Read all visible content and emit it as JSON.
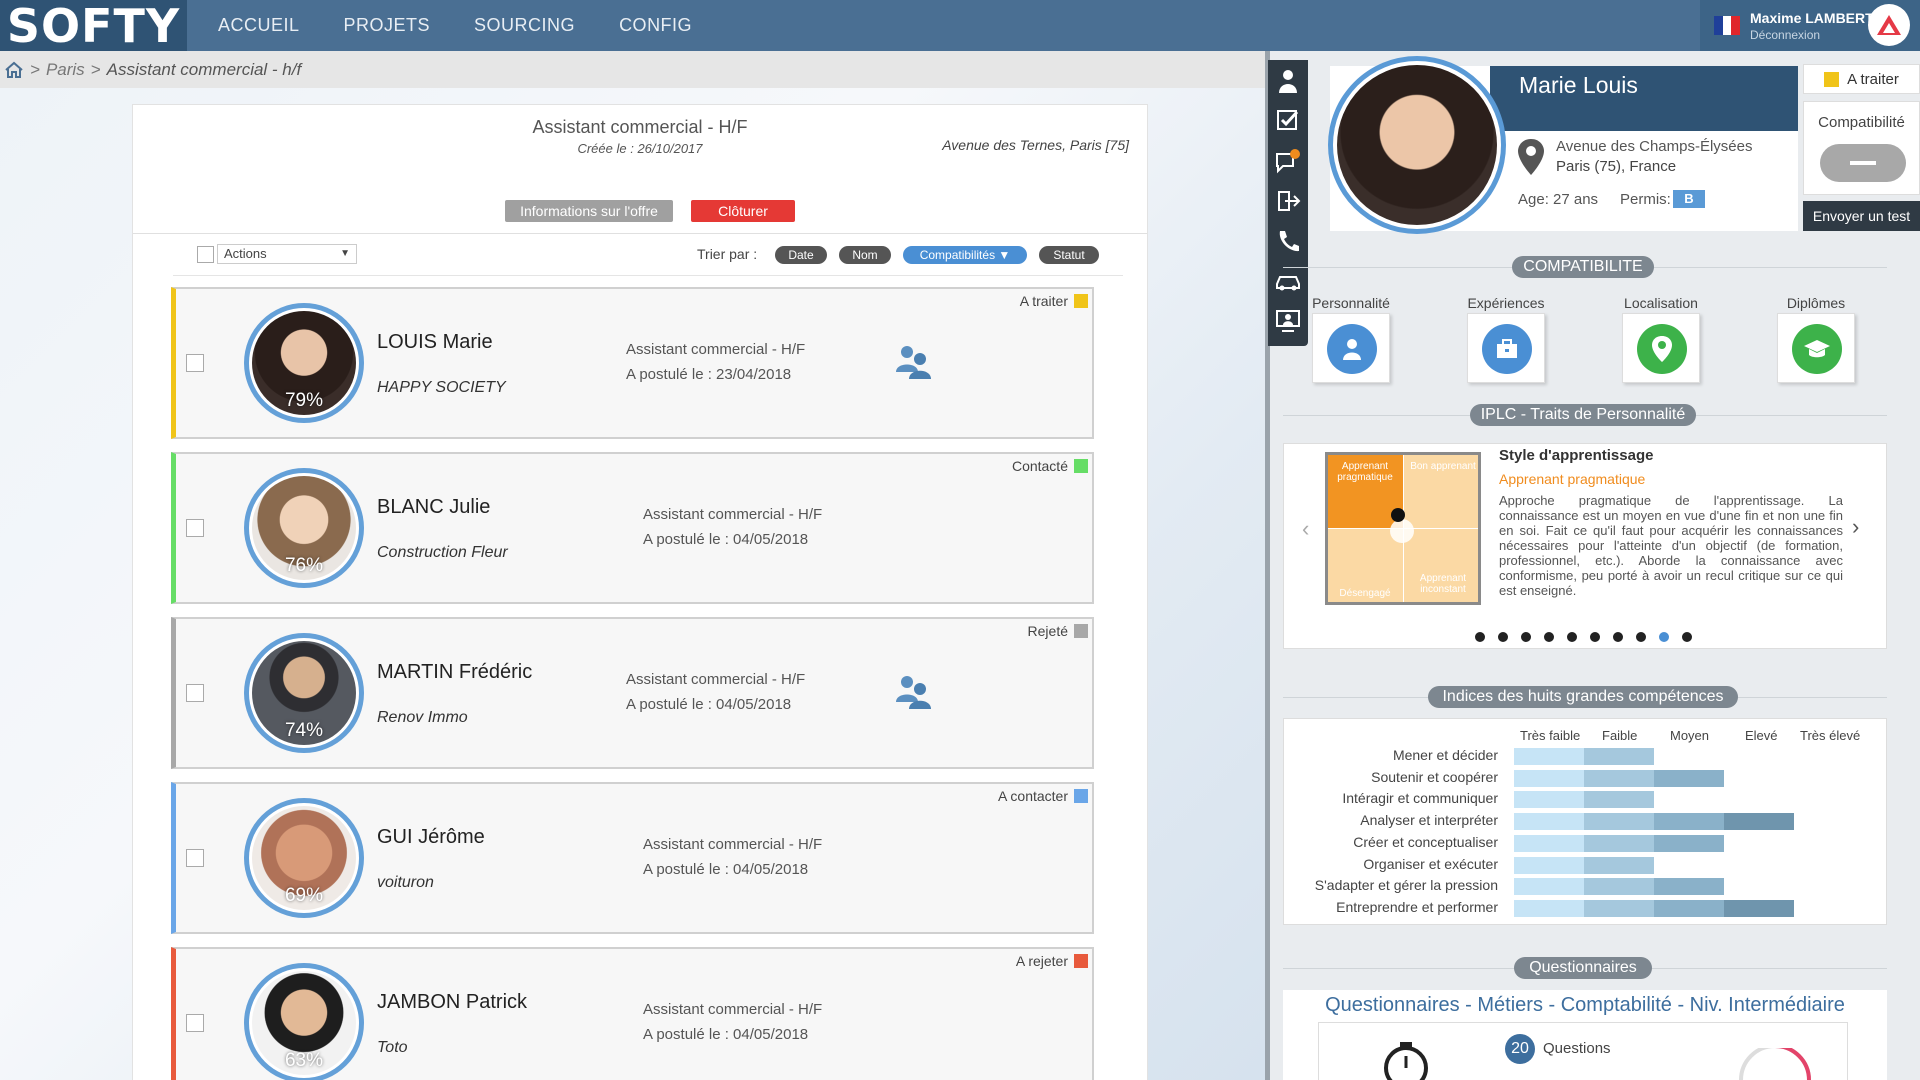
{
  "app": {
    "logo": "SOFTY",
    "nav": [
      "ACCUEIL",
      "PROJETS",
      "SOURCING",
      "CONFIG"
    ],
    "user": {
      "name": "Maxime LAMBERT",
      "logout": "Déconnexion"
    }
  },
  "breadcrumb": {
    "sep1": ">",
    "city": "Paris",
    "sep2": ">",
    "current": "Assistant commercial - h/f"
  },
  "offer": {
    "title": "Assistant commercial - H/F",
    "created": "Créée le : 26/10/2017",
    "location": "Avenue des Ternes, Paris [75]",
    "info_btn": "Informations sur l'offre",
    "close_btn": "Clôturer"
  },
  "toolbar": {
    "actions": "Actions",
    "sort_label": "Trier par :",
    "sort": [
      "Date",
      "Nom",
      "Compatibilités ▼",
      "Statut"
    ]
  },
  "candidates": [
    {
      "name": "LOUIS Marie",
      "company": "HAPPY SOCIETY",
      "pct": "79%",
      "job": "Assistant commercial - H/F",
      "applied": "A postulé le : 23/04/2018",
      "status": "A traiter",
      "color": "#f0c419",
      "team": true
    },
    {
      "name": "BLANC Julie",
      "company": "Construction Fleur",
      "pct": "76%",
      "job": "Assistant commercial - H/F",
      "applied": "A postulé le : 04/05/2018",
      "status": "Contacté",
      "color": "#66dd66",
      "team": false
    },
    {
      "name": "MARTIN Frédéric",
      "company": "Renov Immo",
      "pct": "74%",
      "job": "Assistant commercial - H/F",
      "applied": "A postulé le : 04/05/2018",
      "status": "Rejeté",
      "color": "#a8a8a8",
      "team": true
    },
    {
      "name": "GUI Jérôme",
      "company": "voituron",
      "pct": "69%",
      "job": "Assistant commercial - H/F",
      "applied": "A postulé le : 04/05/2018",
      "status": "A contacter",
      "color": "#6aa6e8",
      "team": false
    },
    {
      "name": "JAMBON Patrick",
      "company": "Toto",
      "pct": "63%",
      "job": "Assistant commercial - H/F",
      "applied": "A postulé le : 04/05/2018",
      "status": "A rejeter",
      "color": "#e85a3c",
      "team": false
    }
  ],
  "profile": {
    "name": "Marie Louis",
    "addr1": "Avenue des Champs-Élysées",
    "addr2": "Paris (75), France",
    "age": "Age: 27 ans",
    "permis_label": "Permis:",
    "permis": "B",
    "status": "A traiter",
    "compat_label": "Compatibilité",
    "test_btn": "Envoyer un test"
  },
  "compatibility": {
    "title": "COMPATIBILITE",
    "items": [
      {
        "label": "Personnalité",
        "color": "#4a8fd4",
        "icon": "person-icon"
      },
      {
        "label": "Expériences",
        "color": "#4a8fd4",
        "icon": "briefcase-icon"
      },
      {
        "label": "Localisation",
        "color": "#3db24a",
        "icon": "map-pin-icon"
      },
      {
        "label": "Diplômes",
        "color": "#3db24a",
        "icon": "graduation-cap-icon"
      }
    ]
  },
  "iplc": {
    "title": "IPLC - Traits de Personnalité",
    "quadrants": [
      "Apprenant pragmatique",
      "Bon apprenant",
      "Désengagé",
      "Apprenant inconstant"
    ],
    "style_title": "Style d'apprentissage",
    "style_sub": "Apprenant pragmatique",
    "style_desc": "Approche pragmatique de l'apprentissage. La connaissance est un moyen en vue d'une fin et non une fin en soi. Fait ce qu'il faut pour acquérir les connaissances nécessaires pour l'atteinte d'un objectif (de formation, professionnel, etc.). Aborde la connaissance avec conformisme, peu porté à avoir un recul critique sur ce qui est enseigné.",
    "dots": 10,
    "active_dot": 8
  },
  "skills": {
    "title": "Indices des huits grandes compétences",
    "levels": [
      "Très faible",
      "Faible",
      "Moyen",
      "Elevé",
      "Très élevé"
    ],
    "rows": [
      {
        "label": "Mener et décider",
        "level": 2
      },
      {
        "label": "Soutenir et coopérer",
        "level": 3
      },
      {
        "label": "Intéragir et communiquer",
        "level": 2
      },
      {
        "label": "Analyser et interpréter",
        "level": 4
      },
      {
        "label": "Créer et conceptualiser",
        "level": 3
      },
      {
        "label": "Organiser et exécuter",
        "level": 2
      },
      {
        "label": "S'adapter et gérer la pression",
        "level": 3
      },
      {
        "label": "Entreprendre et performer",
        "level": 4
      }
    ],
    "seg_colors": [
      "#c6e4f6",
      "#a5c8dd",
      "#8ab1c9",
      "#6f95ad"
    ]
  },
  "questionnaires": {
    "title": "Questionnaires",
    "subtitle": "Questionnaires - Métiers - Comptabilité - Niv. Intermédiaire",
    "count": "20",
    "count_label": "Questions"
  }
}
